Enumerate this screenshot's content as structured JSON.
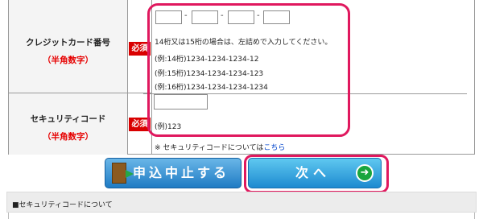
{
  "card_row": {
    "label": "クレジットカード番号",
    "sublabel": "（半角数字）",
    "required": "必須",
    "inputs": [
      "",
      "",
      "",
      ""
    ],
    "separator": "-",
    "hint": "14桁又は15桁の場合は、左詰めで入力してください。",
    "examples": [
      "(例:14桁)1234-1234-1234-12",
      "(例:15桁)1234-1234-1234-123",
      "(例:16桁)1234-1234-1234-1234"
    ]
  },
  "security_row": {
    "label": "セキュリティコード",
    "sublabel": "（半角数字）",
    "required": "必須",
    "input_value": "",
    "example": "(例)123",
    "note_prefix": "※ セキュリティコードについては",
    "note_link": "こちら"
  },
  "buttons": {
    "cancel": "申込中止する",
    "next": "次へ",
    "next_arrow": "➜"
  },
  "info": {
    "title": "■セキュリティコードについて"
  },
  "colors": {
    "highlight": "#e0185e",
    "required_badge": "#d90000",
    "sublabel": "#e60000",
    "link": "#0044cc"
  }
}
